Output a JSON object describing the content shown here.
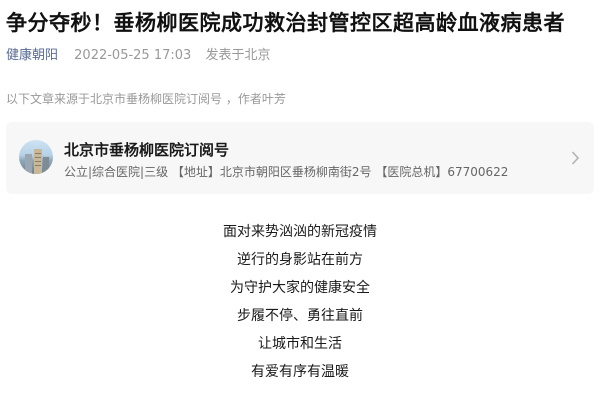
{
  "article": {
    "title": "争分夺秒！垂杨柳医院成功救治封管控区超高龄血液病患者",
    "account": "健康朝阳",
    "time": "2022-05-25 17:03",
    "location": "发表于北京",
    "source_note": "以下文章来源于北京市垂杨柳医院订阅号 ，作者叶芳"
  },
  "source_card": {
    "name": "北京市垂杨柳医院订阅号",
    "description": "公立|综合医院|三级 【地址】北京市朝阳区垂杨柳南街2号 【医院总机】67700622",
    "avatar_icon": "hospital-building-avatar",
    "chevron_icon": "chevron-right-icon"
  },
  "body_lines": [
    "面对来势汹汹的新冠疫情",
    "逆行的身影站在前方",
    "为守护大家的健康安全",
    "步履不停、勇往直前",
    "让城市和生活",
    "有爱有序有温暖"
  ],
  "colors": {
    "account_link": "#576b95",
    "meta_gray": "#999999",
    "card_bg": "#f7f7f7"
  }
}
